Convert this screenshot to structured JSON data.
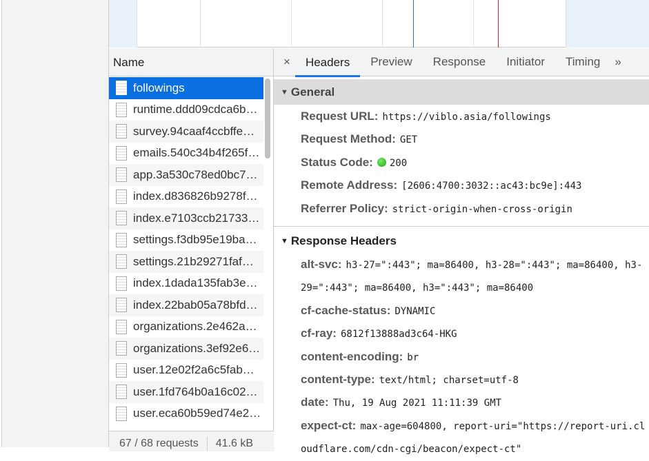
{
  "name_panel": {
    "header": "Name",
    "requests": [
      "followings",
      "runtime.ddd09cdca6b…",
      "survey.94caaf4ccbffe…",
      "emails.540c34b4f265f…",
      "app.3a530c78ed0bc7…",
      "index.d836826b9278f…",
      "index.e7103ccb21733…",
      "settings.f3db95e19ba…",
      "settings.21b29271faf…",
      "index.1dada135fab3e…",
      "index.22bab05a78bfd…",
      "organizations.2e462a…",
      "organizations.3ef92e6…",
      "user.12e02f2a6c5fab…",
      "user.1fd764b0a16c02…",
      "user.eca60b59ed74e2…"
    ],
    "footer": {
      "requests": "67 / 68 requests",
      "size": "41.6 kB"
    }
  },
  "tabs": {
    "close": "×",
    "items": [
      "Headers",
      "Preview",
      "Response",
      "Initiator",
      "Timing"
    ],
    "more": "»",
    "active": "Headers"
  },
  "general": {
    "title": "General",
    "rows": [
      {
        "key": "Request URL:",
        "value": "https://viblo.asia/followings"
      },
      {
        "key": "Request Method:",
        "value": "GET"
      },
      {
        "key": "Status Code:",
        "value": "200"
      },
      {
        "key": "Remote Address:",
        "value": "[2606:4700:3032::ac43:bc9e]:443"
      },
      {
        "key": "Referrer Policy:",
        "value": "strict-origin-when-cross-origin"
      }
    ]
  },
  "response_headers": {
    "title": "Response Headers",
    "rows": [
      {
        "key": "alt-svc:",
        "value": "h3-27=\":443\"; ma=86400, h3-28=\":443\"; ma=86400, h3-29=\":443\"; ma=86400, h3=\":443\"; ma=86400"
      },
      {
        "key": "cf-cache-status:",
        "value": "DYNAMIC"
      },
      {
        "key": "cf-ray:",
        "value": "6812f13888ad3c64-HKG"
      },
      {
        "key": "content-encoding:",
        "value": "br"
      },
      {
        "key": "content-type:",
        "value": "text/html; charset=utf-8"
      },
      {
        "key": "date:",
        "value": "Thu, 19 Aug 2021 11:11:39 GMT"
      },
      {
        "key": "expect-ct:",
        "value": "max-age=604800, report-uri=\"https://report-uri.cloudflare.com/cdn-cgi/beacon/expect-ct\""
      }
    ]
  },
  "colors": {
    "selected": "#0a6fe0",
    "dom_line": "#1a73e8",
    "load_line": "#c62828",
    "status_ok": "#15a80a"
  }
}
